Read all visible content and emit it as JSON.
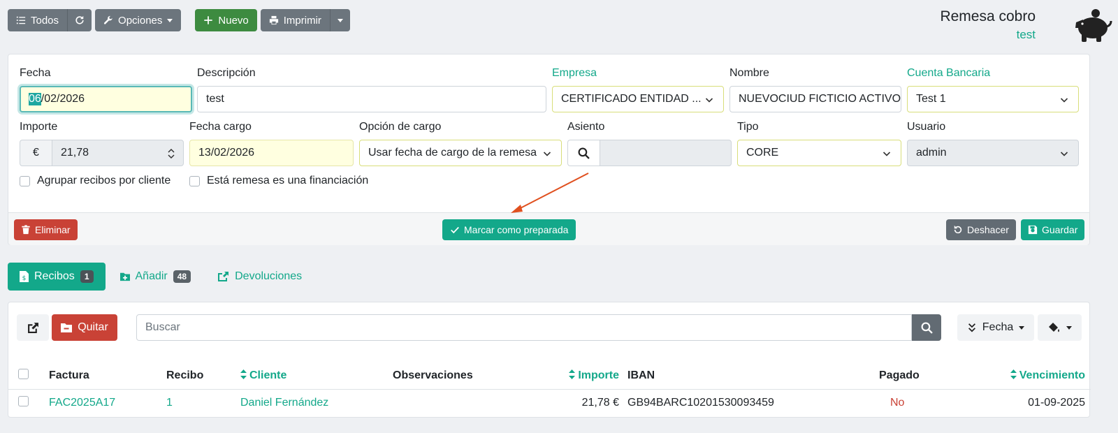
{
  "toolbar": {
    "all_label": "Todos",
    "options_label": "Opciones",
    "new_label": "Nuevo",
    "print_label": "Imprimir"
  },
  "header": {
    "title": "Remesa cobro",
    "subtitle": "test"
  },
  "form": {
    "fecha": {
      "label": "Fecha",
      "day": "06",
      "rest": "/02/2026"
    },
    "descripcion": {
      "label": "Descripción",
      "value": "test"
    },
    "empresa": {
      "label": "Empresa",
      "value": "CERTIFICADO ENTIDAD ..."
    },
    "nombre": {
      "label": "Nombre",
      "value": "NUEVOCIUD FICTICIO ACTIVO"
    },
    "cuenta": {
      "label": "Cuenta Bancaria",
      "value": "Test 1"
    },
    "importe": {
      "label": "Importe",
      "currency": "€",
      "value": "21,78"
    },
    "fecha_cargo": {
      "label": "Fecha cargo",
      "value": "13/02/2026"
    },
    "opcion_cargo": {
      "label": "Opción de cargo",
      "value": "Usar fecha de cargo de la remesa"
    },
    "asiento": {
      "label": "Asiento",
      "value": ""
    },
    "tipo": {
      "label": "Tipo",
      "value": "CORE"
    },
    "usuario": {
      "label": "Usuario",
      "value": "admin"
    },
    "agrupar_label": "Agrupar recibos por cliente",
    "financiacion_label": "Está remesa es una financiación"
  },
  "footer": {
    "delete_label": "Eliminar",
    "mark_label": "Marcar como preparada",
    "undo_label": "Deshacer",
    "save_label": "Guardar"
  },
  "tabs": [
    {
      "label": "Recibos",
      "badge": "1"
    },
    {
      "label": "Añadir",
      "badge": "48"
    },
    {
      "label": "Devoluciones"
    }
  ],
  "list": {
    "remove_label": "Quitar",
    "search_placeholder": "Buscar",
    "sort_label": "Fecha",
    "columns": [
      "Factura",
      "Recibo",
      "Cliente",
      "Observaciones",
      "Importe",
      "IBAN",
      "Pagado",
      "Vencimiento"
    ],
    "rows": [
      {
        "factura": "FAC2025A17",
        "recibo": "1",
        "cliente": "Daniel Fernández",
        "observaciones": "",
        "importe": "21,78 €",
        "iban": "GB94BARC10201530093459",
        "pagado": "No",
        "vencimiento": "01-09-2025"
      }
    ]
  },
  "colors": {
    "accent": "#13a88a",
    "danger": "#c94236",
    "success": "#3d8b40",
    "secondary": "#6c757d",
    "annotation_arrow": "#e0501f"
  }
}
